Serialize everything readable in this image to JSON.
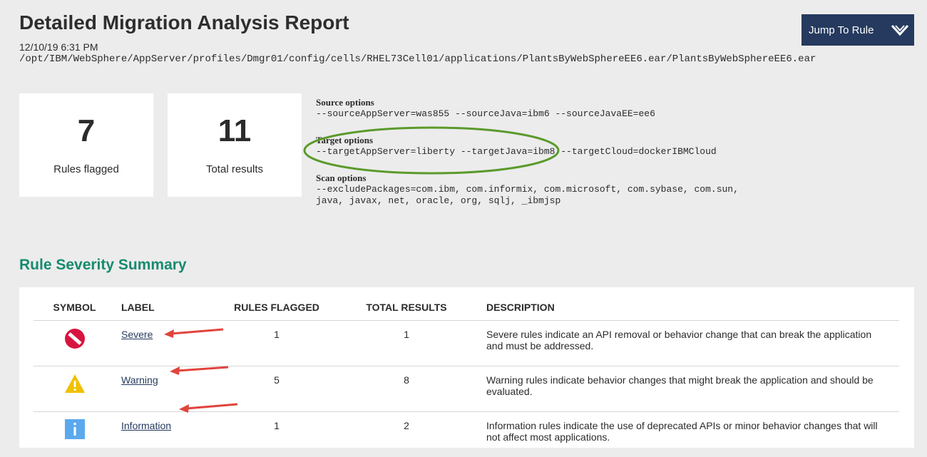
{
  "header": {
    "title": "Detailed Migration Analysis Report",
    "date": "12/10/19 6:31 PM",
    "path": "/opt/IBM/WebSphere/AppServer/profiles/Dmgr01/config/cells/RHEL73Cell01/applications/PlantsByWebSphereEE6.ear/PlantsByWebSphereEE6.ear"
  },
  "jump": {
    "label": "Jump To Rule",
    "icon": "chevron-down-icon"
  },
  "stats": [
    {
      "value": "7",
      "caption": "Rules flagged"
    },
    {
      "value": "11",
      "caption": "Total results"
    }
  ],
  "options": {
    "source": {
      "heading": "Source options",
      "value": "--sourceAppServer=was855 --sourceJava=ibm6 --sourceJavaEE=ee6"
    },
    "target": {
      "heading": "Target options",
      "value": "--targetAppServer=liberty --targetJava=ibm8 --targetCloud=dockerIBMCloud"
    },
    "scan": {
      "heading": "Scan options",
      "line1": "--excludePackages=com.ibm, com.informix, com.microsoft, com.sybase, com.sun,",
      "line2": "java, javax, net, oracle, org, sqlj, _ibmjsp"
    }
  },
  "summary": {
    "title": "Rule Severity Summary",
    "columns": [
      "SYMBOL",
      "LABEL",
      "RULES FLAGGED",
      "TOTAL RESULTS",
      "DESCRIPTION"
    ],
    "rows": [
      {
        "icon": "severe-icon",
        "label": "Severe",
        "rules_flagged": "1",
        "total_results": "1",
        "description": "Severe rules indicate an API removal or behavior change that can break the application and must be addressed."
      },
      {
        "icon": "warning-icon",
        "label": "Warning",
        "rules_flagged": "5",
        "total_results": "8",
        "description": "Warning rules indicate behavior changes that might break the application and should be evaluated."
      },
      {
        "icon": "information-icon",
        "label": "Information",
        "rules_flagged": "1",
        "total_results": "2",
        "description": "Information rules indicate the use of deprecated APIs or minor behavior changes that will not affect most applications."
      }
    ]
  },
  "colors": {
    "title_green": "#178a6f",
    "button_navy": "#253a5e",
    "severe_red": "#d7143f",
    "warning_yellow": "#efc100",
    "info_blue": "#5aa9ee",
    "annotation_green": "#5a9a2a",
    "annotation_red": "#e0443c"
  }
}
